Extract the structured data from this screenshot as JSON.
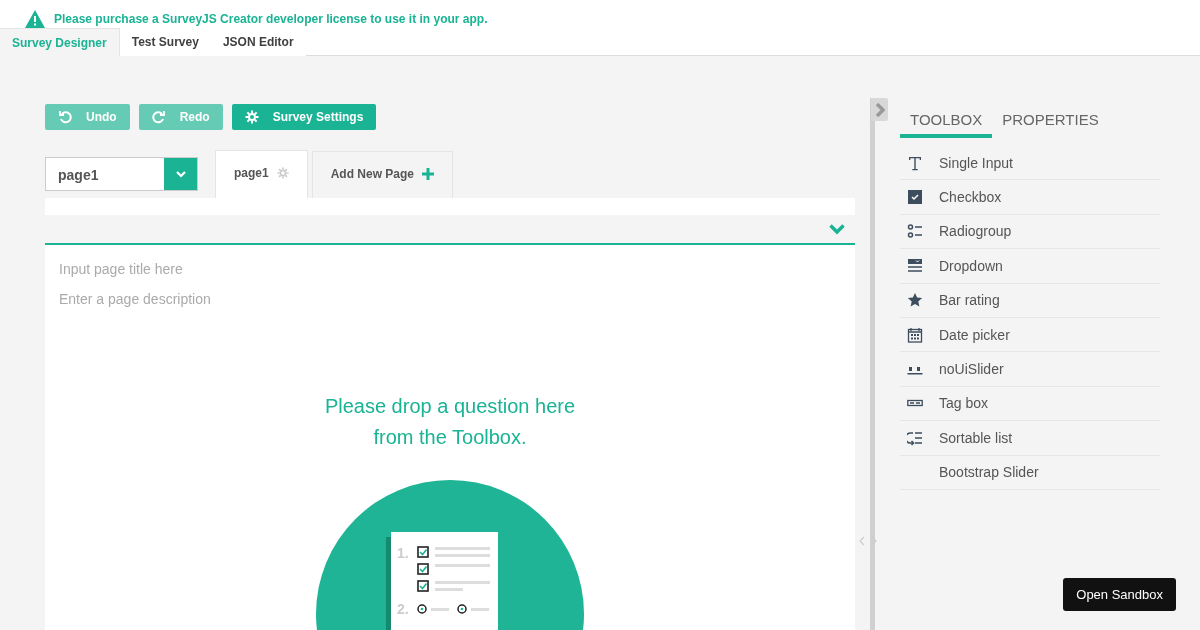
{
  "license_notice": "Please purchase a SurveyJS Creator developer license to use it in your app.",
  "tabs": [
    {
      "label": "Survey Designer",
      "selected": true
    },
    {
      "label": "Test Survey",
      "selected": false
    },
    {
      "label": "JSON Editor",
      "selected": false
    }
  ],
  "toolbar": [
    {
      "label": "Undo",
      "kind": "undo",
      "disabled": true
    },
    {
      "label": "Redo",
      "kind": "redo",
      "disabled": true
    },
    {
      "label": "Survey Settings",
      "kind": "settings",
      "disabled": false
    }
  ],
  "page_select": {
    "value": "page1"
  },
  "page_tabs": [
    {
      "label": "page1",
      "kind": "page",
      "selected": true
    },
    {
      "label": "Add New Page",
      "kind": "add",
      "selected": false
    }
  ],
  "page": {
    "title_placeholder": "Input page title here",
    "description_placeholder": "Enter a page description",
    "drop_hint": [
      "Please drop a question here",
      "from the Toolbox."
    ],
    "illustration_numbers": [
      "1.",
      "2."
    ]
  },
  "sidebar": {
    "tabs": [
      {
        "label": "TOOLBOX",
        "selected": true
      },
      {
        "label": "PROPERTIES",
        "selected": false
      }
    ],
    "items": [
      {
        "label": "Single Input",
        "kind": "text"
      },
      {
        "label": "Checkbox",
        "kind": "checkbox"
      },
      {
        "label": "Radiogroup",
        "kind": "radiogroup"
      },
      {
        "label": "Dropdown",
        "kind": "dropdown"
      },
      {
        "label": "Bar rating",
        "kind": "rating"
      },
      {
        "label": "Date picker",
        "kind": "date"
      },
      {
        "label": "noUiSlider",
        "kind": "slider"
      },
      {
        "label": "Tag box",
        "kind": "tagbox"
      },
      {
        "label": "Sortable list",
        "kind": "sortable"
      },
      {
        "label": "Bootstrap Slider",
        "kind": "none"
      }
    ]
  },
  "sandbox_button": "Open Sandbox"
}
